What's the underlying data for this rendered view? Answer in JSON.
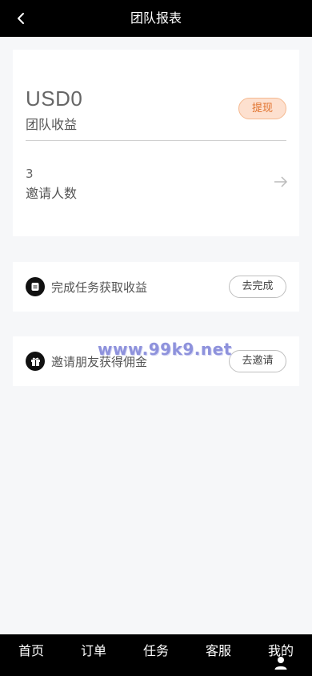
{
  "header": {
    "title": "团队报表",
    "back_icon": "chevron-left-icon"
  },
  "summary": {
    "amount": "USD0",
    "amount_label": "团队收益",
    "withdraw_label": "提现",
    "invite_count": "3",
    "invite_label": "邀请人数",
    "arrow_icon": "arrow-right-icon"
  },
  "tasks": [
    {
      "text": "完成任务获取收益",
      "button": "去完成",
      "icon": "document-icon"
    },
    {
      "text": "邀请朋友获得佣金",
      "button": "去邀请",
      "icon": "gift-icon"
    }
  ],
  "watermark": "www.99k9.net",
  "tabbar": {
    "items": [
      "首页",
      "订单",
      "任务",
      "客服",
      "我的"
    ],
    "profile_icon": "user-icon"
  },
  "colors": {
    "header_bg": "#000000",
    "withdraw_bg": "#fde0cf",
    "withdraw_text": "#e0702a",
    "page_bg": "#f6f7f9"
  }
}
